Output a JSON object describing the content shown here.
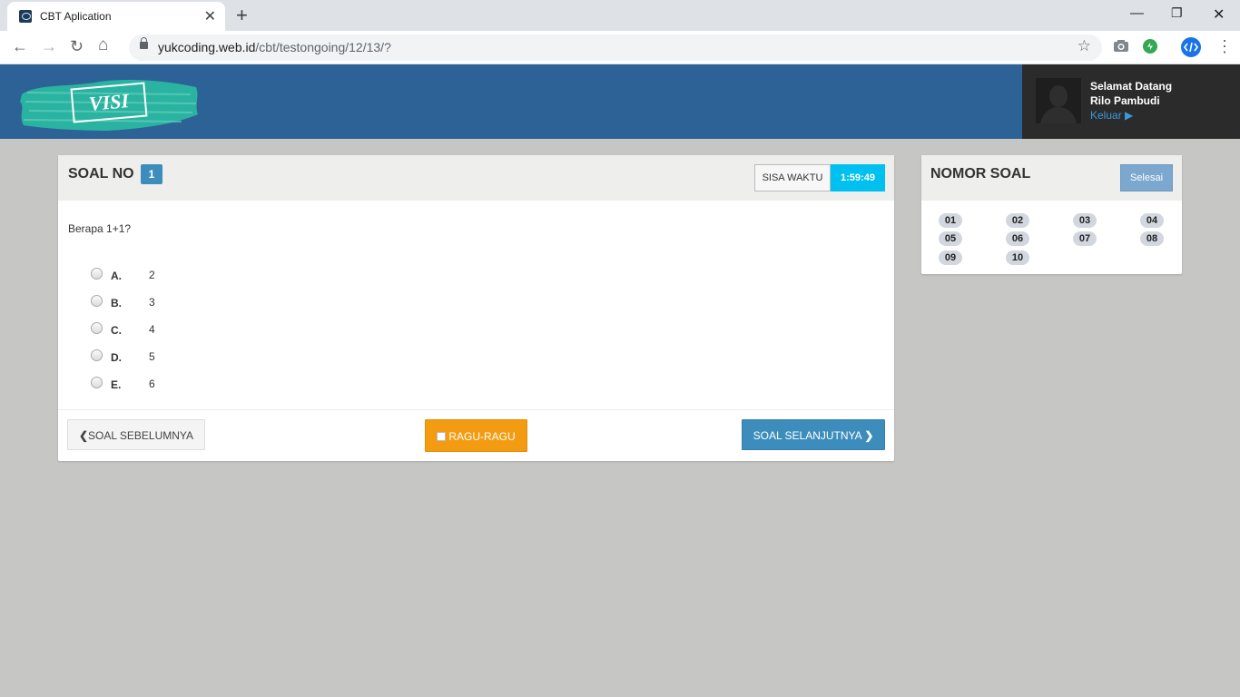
{
  "browser": {
    "tab_title": "CBT Aplication",
    "url_host": "yukcoding.web.id",
    "url_path": "/cbt/testongoing/12/13/?"
  },
  "header": {
    "logo_text": "VISI",
    "welcome": "Selamat Datang",
    "user_name": "Rilo Pambudi",
    "logout_label": "Keluar ▶"
  },
  "question_panel": {
    "title": "SOAL NO",
    "number": "1",
    "timer_label": "SISA WAKTU",
    "timer_value": "1:59:49",
    "question_text": "Berapa 1+1?",
    "options": [
      {
        "letter": "A.",
        "text": "2"
      },
      {
        "letter": "B.",
        "text": "3"
      },
      {
        "letter": "C.",
        "text": "4"
      },
      {
        "letter": "D.",
        "text": "5"
      },
      {
        "letter": "E.",
        "text": "6"
      }
    ],
    "prev_label": "SOAL SEBELUMNYA",
    "doubt_label": "RAGU-RAGU",
    "next_label": "SOAL SELANJUTNYA"
  },
  "nav_panel": {
    "title": "NOMOR SOAL",
    "finish_label": "Selesai",
    "numbers": [
      "01",
      "02",
      "03",
      "04",
      "05",
      "06",
      "07",
      "08",
      "09",
      "10"
    ]
  },
  "colors": {
    "header_bg": "#2d6296",
    "primary": "#3c8dbc",
    "warning": "#f39c12",
    "info": "#00c0ef"
  }
}
